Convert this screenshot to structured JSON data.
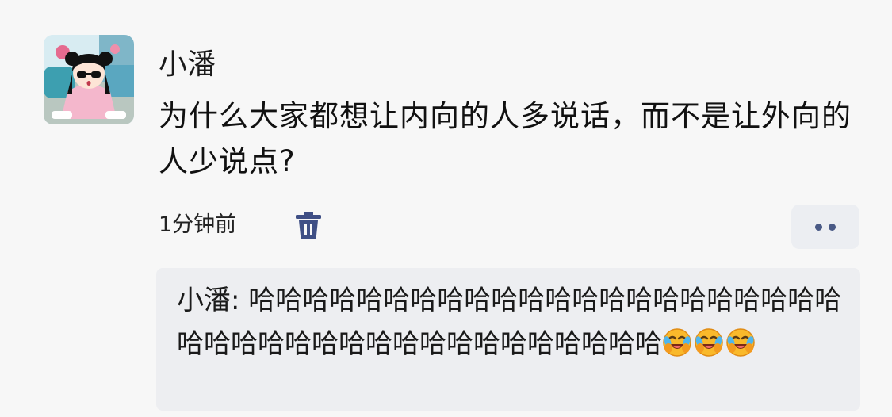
{
  "post": {
    "username": "小潘",
    "text": "为什么大家都想让内向的人多说话，而不是让外向的人少说点?",
    "timestamp": "1分钟前"
  },
  "comment": {
    "author": "小潘",
    "separator": ": ",
    "text": "哈哈哈哈哈哈哈哈哈哈哈哈哈哈哈哈哈哈哈哈哈哈哈哈哈哈哈哈哈哈哈哈哈哈哈哈哈哈哈哈",
    "emojis": [
      "rolling-on-floor-laughing",
      "rolling-on-floor-laughing",
      "rolling-on-floor-laughing"
    ]
  },
  "icons": {
    "delete": "trash-icon",
    "more": "more-dots-icon"
  },
  "colors": {
    "background": "#f7f7f7",
    "comment_background": "#edeef1",
    "icon_blue": "#3f4f85",
    "more_button_background": "#eceef2"
  }
}
